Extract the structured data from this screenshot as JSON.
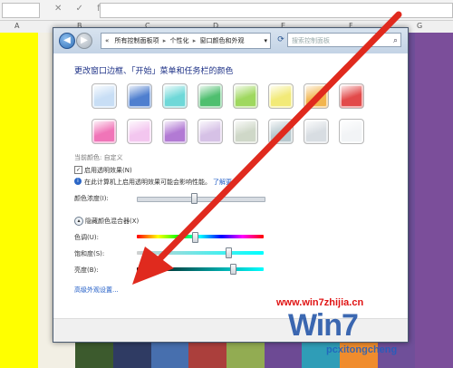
{
  "excel": {
    "columns": [
      "A",
      "B",
      "C",
      "D",
      "E",
      "F",
      "G"
    ],
    "fx_icons": "✕ ✓ fx",
    "stripe_colors": [
      "#ffff00",
      "#f2efe4",
      "#3c5a2d",
      "#2f3b63",
      "#476fae",
      "#ab3f3c",
      "#92ac52",
      "#6d4a94",
      "#2f9db7",
      "#f08c2d",
      "#6f4f99",
      "#7b4e9a"
    ]
  },
  "window": {
    "address": {
      "crumbs": [
        "所有控制面板项",
        "个性化",
        "窗口颜色和外观"
      ],
      "chevron": "«",
      "dropdown": "▾"
    },
    "refresh_glyph": "⟳",
    "search": {
      "placeholder": "搜索控制面板",
      "icon": "search-icon"
    },
    "heading": "更改窗口边框、「开始」菜单和任务栏的颜色",
    "current_color_label": "当前颜色: 自定义",
    "transparency_label": "启用透明效果(N)",
    "transparency_checked": true,
    "info_text": "在此计算机上启用透明效果可能会影响性能。",
    "info_link": "了解更多",
    "intensity_label": "颜色浓度(I):",
    "intensity_value": 0.45,
    "mixer_label": "隐藏颜色混合器(X)",
    "hue_label": "色调(U):",
    "hue_value": 0.46,
    "saturation_label": "饱和度(S):",
    "saturation_value": 0.72,
    "brightness_label": "亮度(B):",
    "brightness_value": 0.76,
    "advanced_link": "高级外观设置..."
  },
  "swatches": {
    "row1": [
      "#c8def5",
      "#4f7fcf",
      "#6fd8d8",
      "#4fbf6f",
      "#9fd85f",
      "#f2ea78",
      "#f2b54f",
      "#e24a4a"
    ],
    "row2": [
      "#f075b8",
      "#f3c6ef",
      "#b27ad4",
      "#d6c1e6",
      "#cfd8c8",
      "#b7c8ce",
      "#d8dde2",
      "#f2f4f6"
    ]
  },
  "arrow": {
    "color": "#e02a1e"
  },
  "watermark": {
    "site": "www.win7zhijia.cn",
    "logo": "Win7",
    "site2": "pcxitongcheng"
  }
}
